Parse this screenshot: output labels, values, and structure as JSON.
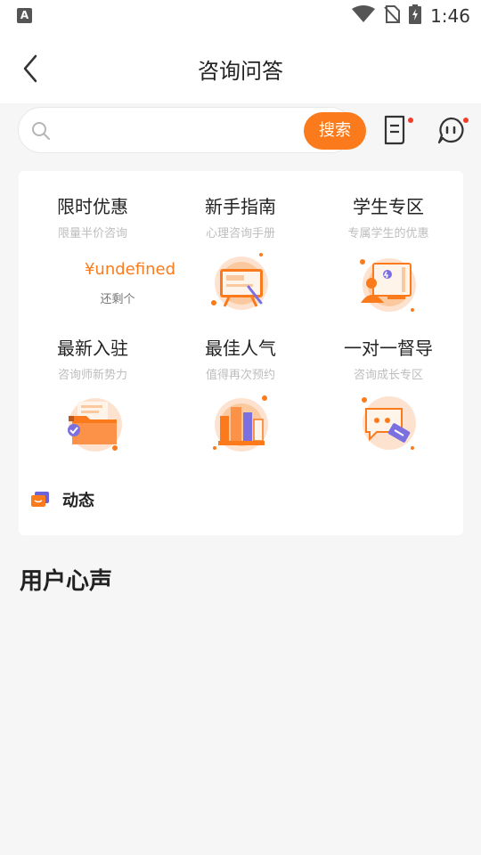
{
  "status_bar": {
    "app_badge": "A",
    "time": "1:46",
    "icons": [
      "wifi-icon",
      "no-sim-icon",
      "battery-charging-icon"
    ]
  },
  "header": {
    "title": "咨询问答",
    "back_icon": "chevron-left-icon"
  },
  "search": {
    "placeholder": "",
    "button_label": "搜索",
    "note_icon": "note-icon",
    "message_icon": "message-icon",
    "accent": "#fb7b1c",
    "dot_color": "#f23d2b"
  },
  "grid": [
    {
      "title": "限时优惠",
      "subtitle": "限量半价咨询",
      "price": "¥undefined",
      "remain": "还剩个"
    },
    {
      "title": "新手指南",
      "subtitle": "心理咨询手册",
      "icon": "easel-icon"
    },
    {
      "title": "学生专区",
      "subtitle": "专属学生的优惠",
      "icon": "student-icon"
    },
    {
      "title": "最新入驻",
      "subtitle": "咨询师新势力",
      "icon": "folder-icon"
    },
    {
      "title": "最佳人气",
      "subtitle": "值得再次预约",
      "icon": "books-icon"
    },
    {
      "title": "一对一督导",
      "subtitle": "咨询成长专区",
      "icon": "chat-ticket-icon"
    }
  ],
  "dynamic": {
    "label": "动态",
    "icon": "chat-bubbles-icon"
  },
  "section": {
    "title": "用户心声"
  }
}
